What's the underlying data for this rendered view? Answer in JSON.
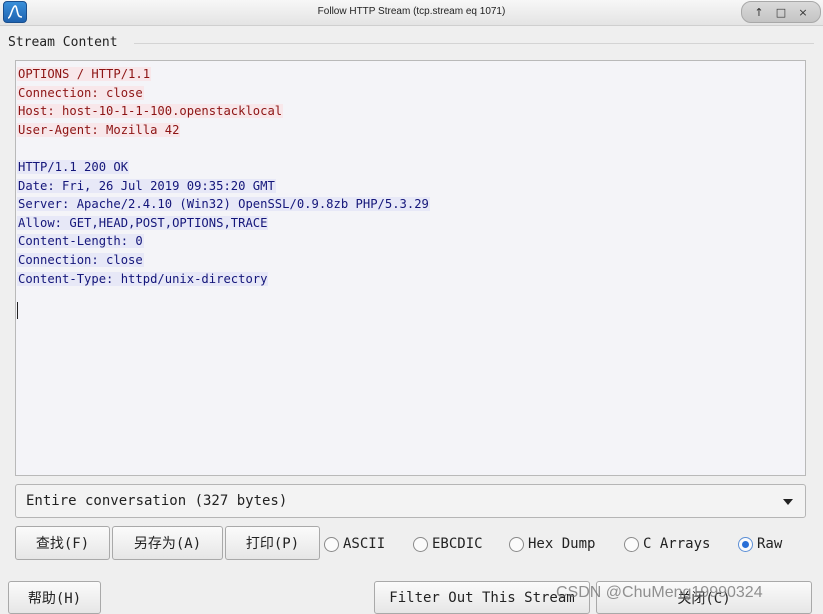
{
  "window": {
    "title": "Follow HTTP Stream (tcp.stream eq 1071)",
    "controls": [
      "↑",
      "□",
      "×"
    ]
  },
  "group_label": "Stream Content",
  "stream": {
    "client_lines": [
      "OPTIONS / HTTP/1.1",
      "Connection: close",
      "Host: host-10-1-1-100.openstacklocal",
      "User-Agent: Mozilla 42"
    ],
    "server_lines": [
      "HTTP/1.1 200 OK",
      "Date: Fri, 26 Jul 2019 09:35:20 GMT",
      "Server: Apache/2.4.10 (Win32) OpenSSL/0.9.8zb PHP/5.3.29",
      "Allow: GET,HEAD,POST,OPTIONS,TRACE",
      "Content-Length: 0",
      "Connection: close",
      "Content-Type: httpd/unix-directory"
    ],
    "client_color": "#8d1414",
    "server_color": "#14167a"
  },
  "conversation_select": "Entire conversation (327 bytes)",
  "buttons": {
    "find": "查找(F)",
    "save_as": "另存为(A)",
    "print": "打印(P)",
    "help": "帮助(H)",
    "filter_out": "Filter Out This Stream",
    "close": "关闭(C)"
  },
  "radios": {
    "ascii": "ASCII",
    "ebcdic": "EBCDIC",
    "hex_dump": "Hex Dump",
    "c_arrays": "C Arrays",
    "raw": "Raw",
    "selected": "Raw"
  },
  "watermark": "CSDN @ChuMeng19990324"
}
